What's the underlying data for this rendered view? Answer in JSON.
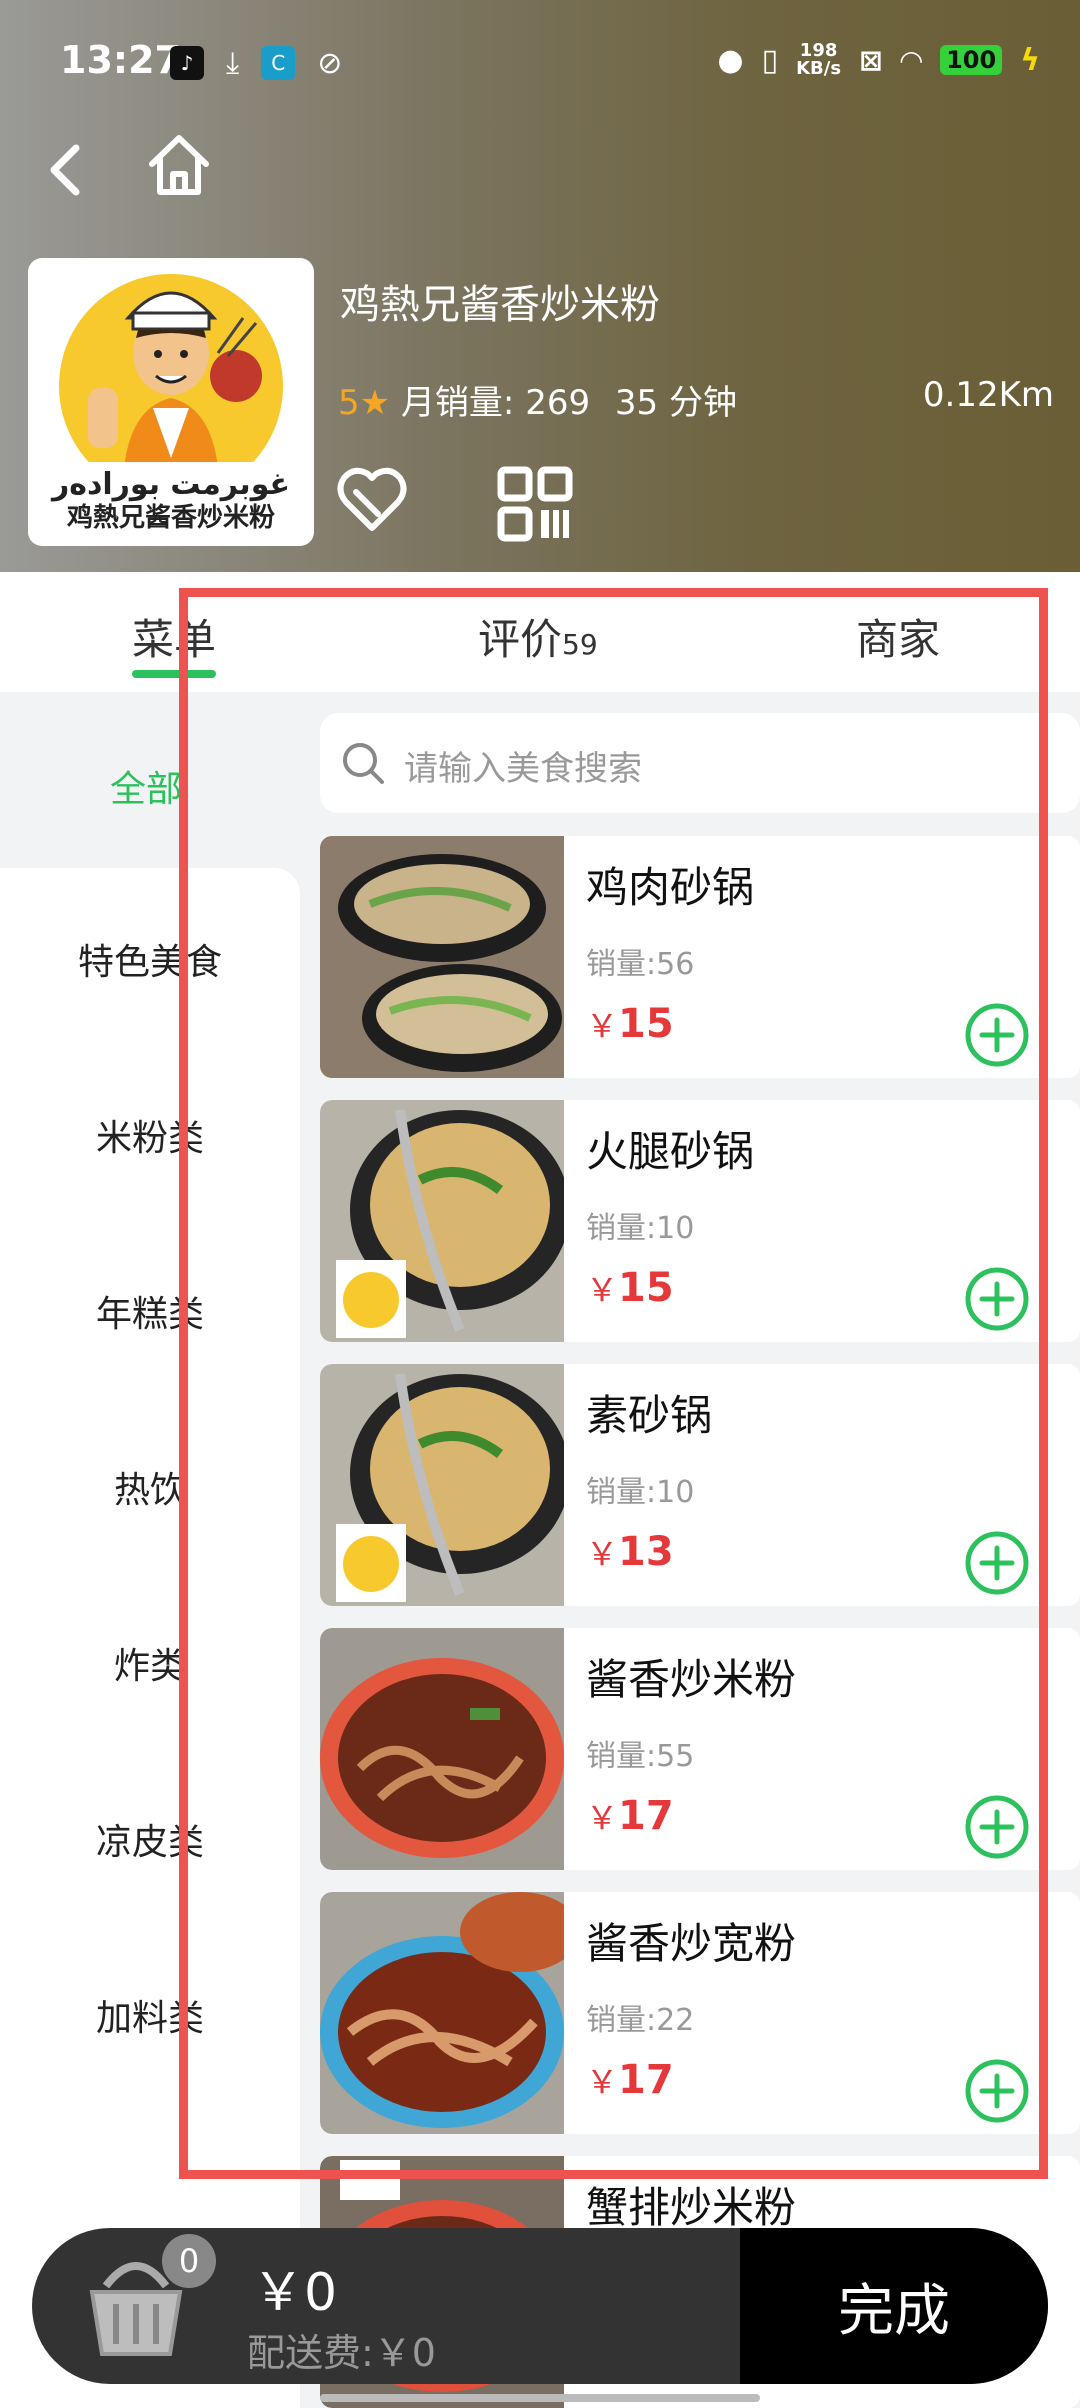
{
  "status_bar": {
    "time": "13:27",
    "speed_value": "198",
    "speed_unit": "KB/s",
    "battery": "100"
  },
  "store": {
    "name": "鸡熱兄酱香炒米粉",
    "rating": "5",
    "monthly_sales": "月销量: 269",
    "delivery_time": "35 分钟",
    "distance": "0.12Km",
    "logo_text_uyghur": "غوبرمت بورادەر",
    "logo_text_cn": "鸡熱兄酱香炒米粉"
  },
  "tabs": {
    "menu": "菜单",
    "reviews": "评价",
    "reviews_count": "59",
    "merchant": "商家"
  },
  "search": {
    "placeholder": "请输入美食搜索"
  },
  "sidebar": {
    "all": "全部",
    "items": [
      {
        "label": "特色美食"
      },
      {
        "label": "米粉类"
      },
      {
        "label": "年糕类"
      },
      {
        "label": "热饮"
      },
      {
        "label": "炸类"
      },
      {
        "label": "凉皮类"
      },
      {
        "label": "加料类"
      }
    ]
  },
  "items": [
    {
      "name": "鸡肉砂锅",
      "sales": "销量:56",
      "currency": "￥",
      "price": "15"
    },
    {
      "name": "火腿砂锅",
      "sales": "销量:10",
      "currency": "￥",
      "price": "15"
    },
    {
      "name": "素砂锅",
      "sales": "销量:10",
      "currency": "￥",
      "price": "13"
    },
    {
      "name": "酱香炒米粉",
      "sales": "销量:55",
      "currency": "￥",
      "price": "17"
    },
    {
      "name": "酱香炒宽粉",
      "sales": "销量:22",
      "currency": "￥",
      "price": "17"
    },
    {
      "name": "蟹排炒米粉"
    }
  ],
  "cart": {
    "count": "0",
    "total": "￥0",
    "delivery_fee": "配送费:￥0",
    "done": "完成"
  },
  "colors": {
    "accent": "#2cc15c",
    "price": "#e5383b",
    "highlight_box": "#ef5350"
  }
}
